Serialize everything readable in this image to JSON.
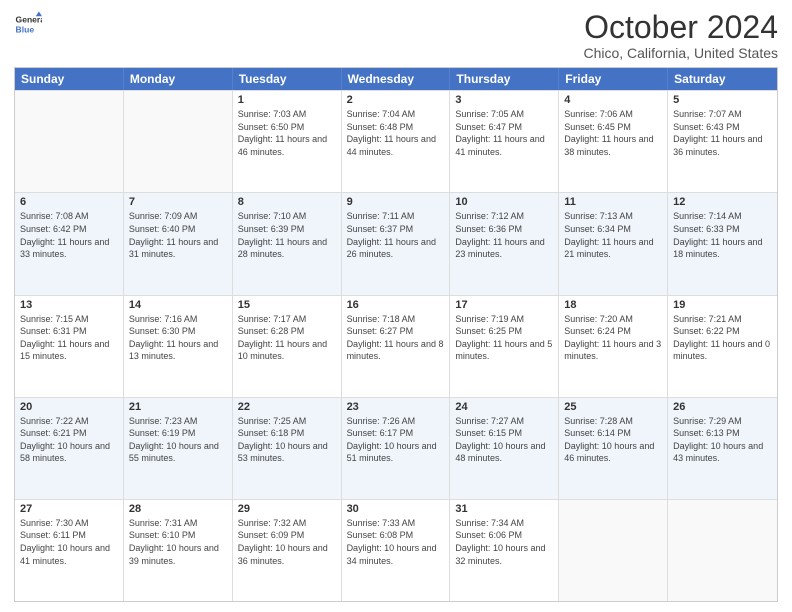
{
  "header": {
    "logo_line1": "General",
    "logo_line2": "Blue",
    "month": "October 2024",
    "location": "Chico, California, United States"
  },
  "days_of_week": [
    "Sunday",
    "Monday",
    "Tuesday",
    "Wednesday",
    "Thursday",
    "Friday",
    "Saturday"
  ],
  "rows": [
    [
      {
        "day": "",
        "info": ""
      },
      {
        "day": "",
        "info": ""
      },
      {
        "day": "1",
        "info": "Sunrise: 7:03 AM\nSunset: 6:50 PM\nDaylight: 11 hours and 46 minutes."
      },
      {
        "day": "2",
        "info": "Sunrise: 7:04 AM\nSunset: 6:48 PM\nDaylight: 11 hours and 44 minutes."
      },
      {
        "day": "3",
        "info": "Sunrise: 7:05 AM\nSunset: 6:47 PM\nDaylight: 11 hours and 41 minutes."
      },
      {
        "day": "4",
        "info": "Sunrise: 7:06 AM\nSunset: 6:45 PM\nDaylight: 11 hours and 38 minutes."
      },
      {
        "day": "5",
        "info": "Sunrise: 7:07 AM\nSunset: 6:43 PM\nDaylight: 11 hours and 36 minutes."
      }
    ],
    [
      {
        "day": "6",
        "info": "Sunrise: 7:08 AM\nSunset: 6:42 PM\nDaylight: 11 hours and 33 minutes."
      },
      {
        "day": "7",
        "info": "Sunrise: 7:09 AM\nSunset: 6:40 PM\nDaylight: 11 hours and 31 minutes."
      },
      {
        "day": "8",
        "info": "Sunrise: 7:10 AM\nSunset: 6:39 PM\nDaylight: 11 hours and 28 minutes."
      },
      {
        "day": "9",
        "info": "Sunrise: 7:11 AM\nSunset: 6:37 PM\nDaylight: 11 hours and 26 minutes."
      },
      {
        "day": "10",
        "info": "Sunrise: 7:12 AM\nSunset: 6:36 PM\nDaylight: 11 hours and 23 minutes."
      },
      {
        "day": "11",
        "info": "Sunrise: 7:13 AM\nSunset: 6:34 PM\nDaylight: 11 hours and 21 minutes."
      },
      {
        "day": "12",
        "info": "Sunrise: 7:14 AM\nSunset: 6:33 PM\nDaylight: 11 hours and 18 minutes."
      }
    ],
    [
      {
        "day": "13",
        "info": "Sunrise: 7:15 AM\nSunset: 6:31 PM\nDaylight: 11 hours and 15 minutes."
      },
      {
        "day": "14",
        "info": "Sunrise: 7:16 AM\nSunset: 6:30 PM\nDaylight: 11 hours and 13 minutes."
      },
      {
        "day": "15",
        "info": "Sunrise: 7:17 AM\nSunset: 6:28 PM\nDaylight: 11 hours and 10 minutes."
      },
      {
        "day": "16",
        "info": "Sunrise: 7:18 AM\nSunset: 6:27 PM\nDaylight: 11 hours and 8 minutes."
      },
      {
        "day": "17",
        "info": "Sunrise: 7:19 AM\nSunset: 6:25 PM\nDaylight: 11 hours and 5 minutes."
      },
      {
        "day": "18",
        "info": "Sunrise: 7:20 AM\nSunset: 6:24 PM\nDaylight: 11 hours and 3 minutes."
      },
      {
        "day": "19",
        "info": "Sunrise: 7:21 AM\nSunset: 6:22 PM\nDaylight: 11 hours and 0 minutes."
      }
    ],
    [
      {
        "day": "20",
        "info": "Sunrise: 7:22 AM\nSunset: 6:21 PM\nDaylight: 10 hours and 58 minutes."
      },
      {
        "day": "21",
        "info": "Sunrise: 7:23 AM\nSunset: 6:19 PM\nDaylight: 10 hours and 55 minutes."
      },
      {
        "day": "22",
        "info": "Sunrise: 7:25 AM\nSunset: 6:18 PM\nDaylight: 10 hours and 53 minutes."
      },
      {
        "day": "23",
        "info": "Sunrise: 7:26 AM\nSunset: 6:17 PM\nDaylight: 10 hours and 51 minutes."
      },
      {
        "day": "24",
        "info": "Sunrise: 7:27 AM\nSunset: 6:15 PM\nDaylight: 10 hours and 48 minutes."
      },
      {
        "day": "25",
        "info": "Sunrise: 7:28 AM\nSunset: 6:14 PM\nDaylight: 10 hours and 46 minutes."
      },
      {
        "day": "26",
        "info": "Sunrise: 7:29 AM\nSunset: 6:13 PM\nDaylight: 10 hours and 43 minutes."
      }
    ],
    [
      {
        "day": "27",
        "info": "Sunrise: 7:30 AM\nSunset: 6:11 PM\nDaylight: 10 hours and 41 minutes."
      },
      {
        "day": "28",
        "info": "Sunrise: 7:31 AM\nSunset: 6:10 PM\nDaylight: 10 hours and 39 minutes."
      },
      {
        "day": "29",
        "info": "Sunrise: 7:32 AM\nSunset: 6:09 PM\nDaylight: 10 hours and 36 minutes."
      },
      {
        "day": "30",
        "info": "Sunrise: 7:33 AM\nSunset: 6:08 PM\nDaylight: 10 hours and 34 minutes."
      },
      {
        "day": "31",
        "info": "Sunrise: 7:34 AM\nSunset: 6:06 PM\nDaylight: 10 hours and 32 minutes."
      },
      {
        "day": "",
        "info": ""
      },
      {
        "day": "",
        "info": ""
      }
    ]
  ]
}
